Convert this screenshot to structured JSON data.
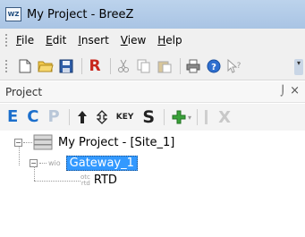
{
  "window": {
    "title": "My Project - BreeZ",
    "app_icon_text": "WZ"
  },
  "menubar": {
    "items": [
      {
        "key": "F",
        "rest": "ile"
      },
      {
        "key": "E",
        "rest": "dit"
      },
      {
        "key": "I",
        "rest": "nsert"
      },
      {
        "key": "V",
        "rest": "iew"
      },
      {
        "key": "H",
        "rest": "elp"
      }
    ]
  },
  "toolbar": {
    "buttons": [
      "new-file-icon",
      "open-folder-icon",
      "save-icon",
      "r-icon",
      "cut-icon",
      "copy-icon",
      "paste-icon",
      "print-icon",
      "help-icon",
      "context-help-icon"
    ],
    "r_label": "R"
  },
  "panel": {
    "title": "Project",
    "pin_glyph": "⌡",
    "close_glyph": "×"
  },
  "project_toolbar": {
    "e_label": "E",
    "c_label": "C",
    "p_label": "P",
    "key_label": "KEY",
    "s_label": "S",
    "x_label": "X"
  },
  "tree": {
    "root": {
      "label": "My Project - [Site_1]",
      "expander": "−"
    },
    "gateway": {
      "tag": "wio",
      "label": "Gateway_1",
      "expander": "−"
    },
    "rtd": {
      "tag_top": "otc",
      "tag_bottom": "rtd",
      "label": "RTD"
    }
  },
  "colors": {
    "accent_blue": "#1c6fcc",
    "selection": "#3399ff",
    "green_add": "#3aa23a",
    "red_r": "#c8261c"
  }
}
